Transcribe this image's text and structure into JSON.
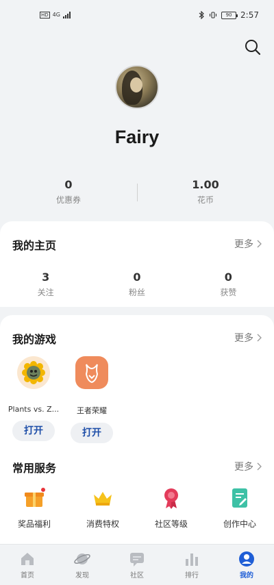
{
  "status_bar": {
    "network": "4G",
    "battery": "90",
    "time": "2:57"
  },
  "profile": {
    "username": "Fairy",
    "coupons": {
      "value": "0",
      "label": "优惠券"
    },
    "coins": {
      "value": "1.00",
      "label": "花币"
    }
  },
  "home_section": {
    "title": "我的主页",
    "more": "更多",
    "stats": [
      {
        "value": "3",
        "label": "关注"
      },
      {
        "value": "0",
        "label": "粉丝"
      },
      {
        "value": "0",
        "label": "获赞"
      }
    ]
  },
  "games_section": {
    "title": "我的游戏",
    "more": "更多",
    "games": [
      {
        "name": "Plants vs. Z...",
        "button": "打开"
      },
      {
        "name": "王者荣耀",
        "button": "打开"
      }
    ]
  },
  "services_section": {
    "title": "常用服务",
    "more": "更多",
    "items": [
      {
        "label": "奖品福利",
        "icon": "gift-icon"
      },
      {
        "label": "消费特权",
        "icon": "crown-icon"
      },
      {
        "label": "社区等级",
        "icon": "medal-icon"
      },
      {
        "label": "创作中心",
        "icon": "document-edit-icon"
      }
    ]
  },
  "tab_bar": {
    "tabs": [
      {
        "label": "首页",
        "icon": "home-icon"
      },
      {
        "label": "发现",
        "icon": "planet-icon"
      },
      {
        "label": "社区",
        "icon": "chat-icon"
      },
      {
        "label": "排行",
        "icon": "bar-chart-icon"
      },
      {
        "label": "我的",
        "icon": "user-icon"
      }
    ],
    "active_index": 4
  },
  "colors": {
    "accent": "#1f5ed6",
    "background": "#f1f3f5",
    "open_button_text": "#1e4ea8"
  }
}
